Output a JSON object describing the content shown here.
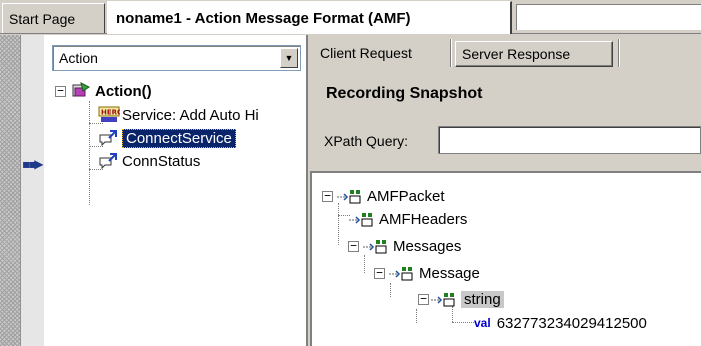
{
  "tabs": {
    "start_page": "Start Page",
    "active_document": "noname1 - Action Message Format (AMF)"
  },
  "left_pane": {
    "combo_value": "Action",
    "tree": {
      "root": "Action()",
      "children": [
        {
          "label": "Service: Add Auto Hi",
          "icon": "hero-service-icon"
        },
        {
          "label": "ConnectService",
          "icon": "amf-step-icon",
          "selected": true
        },
        {
          "label": "ConnStatus",
          "icon": "amf-step-icon"
        }
      ]
    }
  },
  "right_pane": {
    "tabs": [
      "Client Request",
      "Server Response"
    ],
    "section_title": "Recording Snapshot",
    "xpath_label": "XPath Query:",
    "xpath_value": "",
    "xml_tree": {
      "root": "AMFPacket",
      "headers": "AMFHeaders",
      "messages": "Messages",
      "message": "Message",
      "string": "string",
      "val_tag": "val",
      "val_value": "632773234029412500"
    }
  },
  "colors": {
    "selection": "#0a246a",
    "chrome": "#d4d0c8",
    "val_tag": "#0000cc"
  }
}
